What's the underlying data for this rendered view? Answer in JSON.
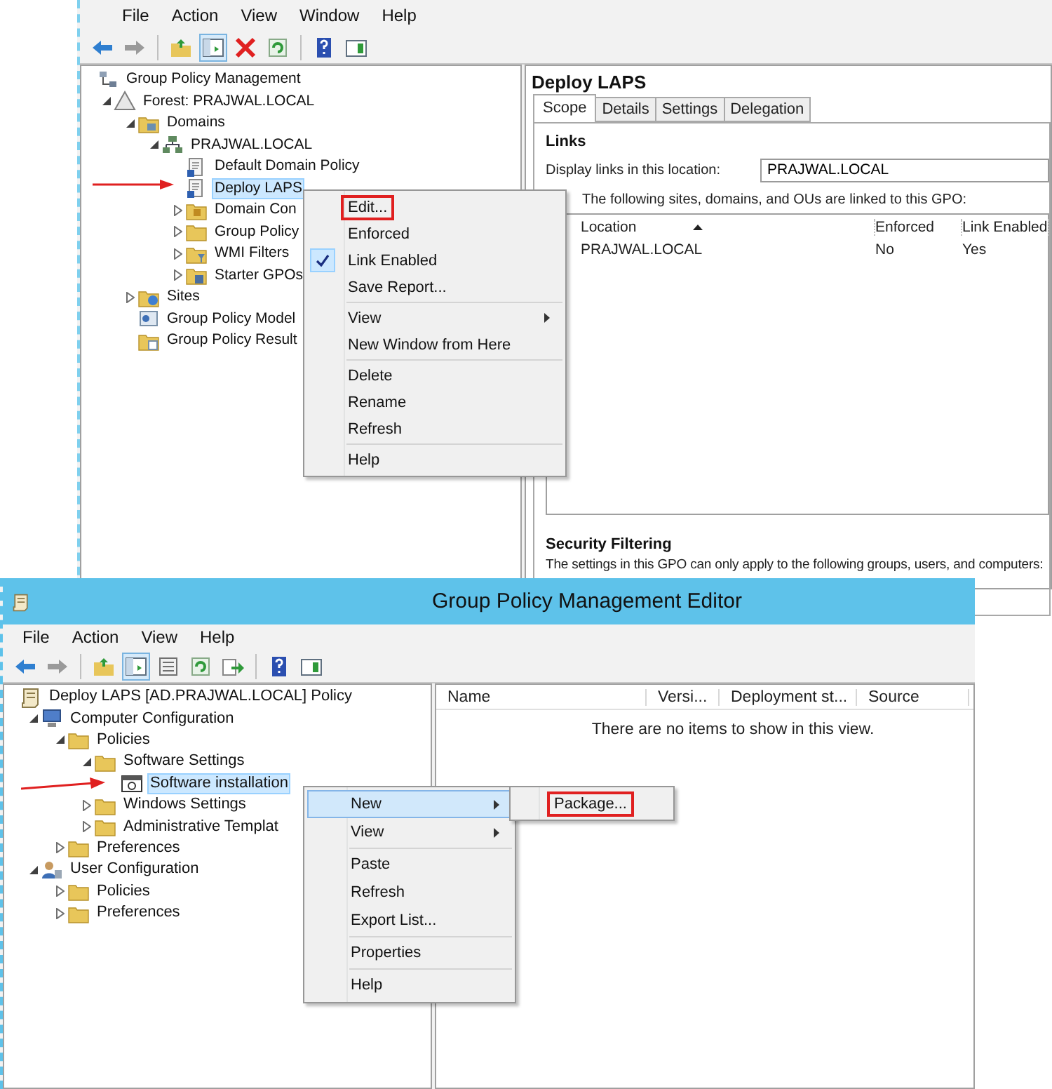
{
  "top_window": {
    "menu": [
      "File",
      "Action",
      "View",
      "Window",
      "Help"
    ],
    "tree": [
      {
        "label": "Group Policy Management",
        "kind": "console",
        "expandable": false,
        "selected": false,
        "children": [
          {
            "label": "Forest: PRAJWAL.LOCAL",
            "kind": "forest",
            "expandable": true,
            "expanded": true,
            "selected": false,
            "children": [
              {
                "label": "Domains",
                "kind": "domains",
                "expandable": true,
                "expanded": true,
                "selected": false,
                "children": [
                  {
                    "label": "PRAJWAL.LOCAL",
                    "kind": "domain",
                    "expandable": true,
                    "expanded": true,
                    "selected": false,
                    "children": [
                      {
                        "label": "Default Domain Policy",
                        "kind": "gpo",
                        "expandable": false,
                        "selected": false
                      },
                      {
                        "label": "Deploy LAPS",
                        "kind": "gpo",
                        "expandable": false,
                        "selected": true
                      },
                      {
                        "label": "Domain Con",
                        "kind": "ou",
                        "expandable": true,
                        "expanded": false,
                        "selected": false
                      },
                      {
                        "label": "Group Policy",
                        "kind": "folder",
                        "expandable": true,
                        "expanded": false,
                        "selected": false
                      },
                      {
                        "label": "WMI Filters",
                        "kind": "filter",
                        "expandable": true,
                        "expanded": false,
                        "selected": false
                      },
                      {
                        "label": "Starter GPOs",
                        "kind": "starter",
                        "expandable": true,
                        "expanded": false,
                        "selected": false
                      }
                    ]
                  }
                ]
              },
              {
                "label": "Sites",
                "kind": "sites",
                "expandable": true,
                "expanded": false,
                "selected": false
              },
              {
                "label": "Group Policy Model",
                "kind": "modeling",
                "expandable": false,
                "selected": false
              },
              {
                "label": "Group Policy Result",
                "kind": "results",
                "expandable": false,
                "selected": false
              }
            ]
          }
        ]
      }
    ],
    "details": {
      "title": "Deploy LAPS",
      "tabs": [
        {
          "label": "Scope",
          "selected": true
        },
        {
          "label": "Details",
          "selected": false
        },
        {
          "label": "Settings",
          "selected": false
        },
        {
          "label": "Delegation",
          "selected": false
        }
      ],
      "links_heading": "Links",
      "location_label": "Display links in this location:",
      "location_value": "PRAJWAL.LOCAL",
      "list_caption": "The following sites, domains, and OUs are linked to this GPO:",
      "columns": [
        "Location",
        "Enforced",
        "Link Enabled"
      ],
      "rows": [
        [
          "PRAJWAL.LOCAL",
          "No",
          "Yes"
        ]
      ],
      "filtering_heading": "Security Filtering",
      "filtering_caption": "The settings in this GPO can only apply to the following groups, users, and computers:"
    },
    "context_menu": [
      [
        {
          "label": "Edit...",
          "outlined": true,
          "checked": false,
          "submenu": false
        },
        {
          "label": "Enforced",
          "outlined": false,
          "checked": false,
          "submenu": false
        },
        {
          "label": "Link Enabled",
          "outlined": false,
          "checked": true,
          "submenu": false
        },
        {
          "label": "Save Report...",
          "outlined": false,
          "checked": false,
          "submenu": false
        }
      ],
      [
        {
          "label": "View",
          "outlined": false,
          "checked": false,
          "submenu": true
        },
        {
          "label": "New Window from Here",
          "outlined": false,
          "checked": false,
          "submenu": false
        }
      ],
      [
        {
          "label": "Delete",
          "outlined": false,
          "checked": false,
          "submenu": false
        },
        {
          "label": "Rename",
          "outlined": false,
          "checked": false,
          "submenu": false
        },
        {
          "label": "Refresh",
          "outlined": false,
          "checked": false,
          "submenu": false
        }
      ],
      [
        {
          "label": "Help",
          "outlined": false,
          "checked": false,
          "submenu": false
        }
      ]
    ]
  },
  "editor_window": {
    "title": "Group Policy Management Editor",
    "menu": [
      "File",
      "Action",
      "View",
      "Help"
    ],
    "tree": [
      {
        "label": "Deploy LAPS [AD.PRAJWAL.LOCAL] Policy",
        "kind": "policy",
        "expandable": false,
        "selected": false,
        "children": [
          {
            "label": "Computer Configuration",
            "kind": "computer",
            "expandable": true,
            "expanded": true,
            "selected": false,
            "children": [
              {
                "label": "Policies",
                "kind": "folder",
                "expandable": true,
                "expanded": true,
                "selected": false,
                "children": [
                  {
                    "label": "Software Settings",
                    "kind": "folder",
                    "expandable": true,
                    "expanded": true,
                    "selected": false,
                    "children": [
                      {
                        "label": "Software installation",
                        "kind": "software",
                        "expandable": false,
                        "selected": true
                      }
                    ]
                  },
                  {
                    "label": "Windows Settings",
                    "kind": "folder",
                    "expandable": true,
                    "expanded": false,
                    "selected": false
                  },
                  {
                    "label": "Administrative Templat",
                    "kind": "folder",
                    "expandable": true,
                    "expanded": false,
                    "selected": false
                  }
                ]
              },
              {
                "label": "Preferences",
                "kind": "folder",
                "expandable": true,
                "expanded": false,
                "selected": false
              }
            ]
          },
          {
            "label": "User Configuration",
            "kind": "user",
            "expandable": true,
            "expanded": true,
            "selected": false,
            "children": [
              {
                "label": "Policies",
                "kind": "folder",
                "expandable": true,
                "expanded": false,
                "selected": false
              },
              {
                "label": "Preferences",
                "kind": "folder",
                "expandable": true,
                "expanded": false,
                "selected": false
              }
            ]
          }
        ]
      }
    ],
    "columns": [
      "Name",
      "Versi...",
      "Deployment st...",
      "Source"
    ],
    "empty_message": "There are no items to show in this view.",
    "context_menu": [
      [
        {
          "label": "New",
          "selected": true,
          "submenu": true
        },
        {
          "label": "View",
          "selected": false,
          "submenu": true
        }
      ],
      [
        {
          "label": "Paste",
          "selected": false,
          "submenu": false
        },
        {
          "label": "Refresh",
          "selected": false,
          "submenu": false
        },
        {
          "label": "Export List...",
          "selected": false,
          "submenu": false
        }
      ],
      [
        {
          "label": "Properties",
          "selected": false,
          "submenu": false
        }
      ],
      [
        {
          "label": "Help",
          "selected": false,
          "submenu": false
        }
      ]
    ],
    "submenu": [
      {
        "label": "Package...",
        "outlined": true
      }
    ]
  }
}
